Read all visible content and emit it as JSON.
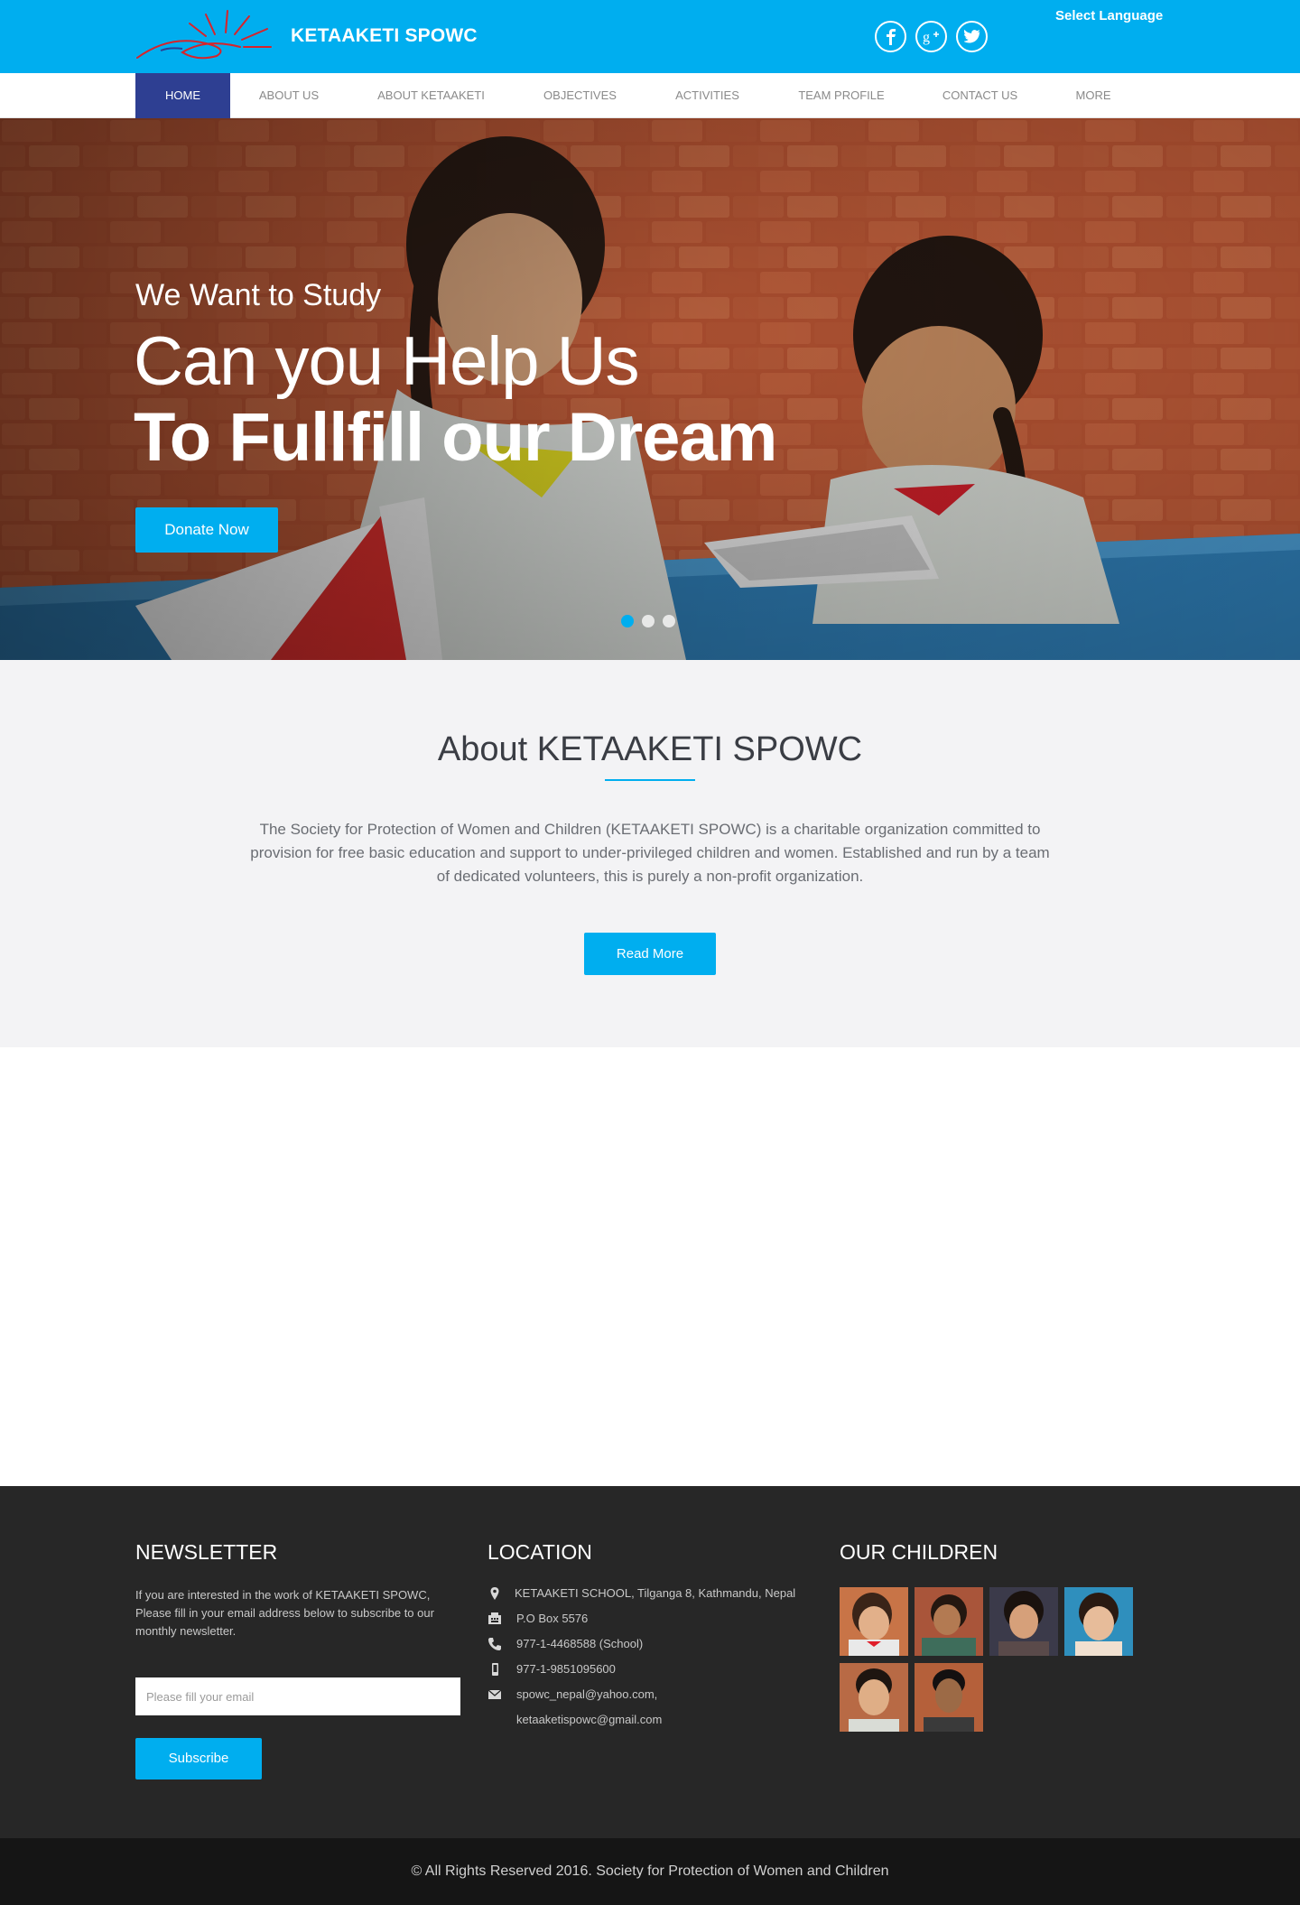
{
  "header": {
    "brand": "KETAAKETI SPOWC",
    "select_language": "Select Language",
    "social": [
      "facebook-icon",
      "google-plus-icon",
      "twitter-icon"
    ]
  },
  "nav": {
    "items": [
      "HOME",
      "ABOUT US",
      "ABOUT KETAAKETI",
      "OBJECTIVES",
      "ACTIVITIES",
      "TEAM PROFILE",
      "CONTACT US",
      "MORE"
    ],
    "active_index": 0
  },
  "hero": {
    "line1": "We Want to Study",
    "line2": "Can you Help Us",
    "line3": "To Fullfill our Dream",
    "donate_label": "Donate Now",
    "slides": 3,
    "active_slide": 0
  },
  "about": {
    "title": "About KETAAKETI SPOWC",
    "text": "The Society for Protection of Women and Children (KETAAKETI SPOWC) is a charitable organization committed to provision for free basic education and support to under-privileged children and women. Established and run by a team of dedicated volunteers, this is purely a non-profit organization.",
    "read_more": "Read More"
  },
  "footer": {
    "newsletter": {
      "title": "NEWSLETTER",
      "text": "If you are interested in the work of KETAAKETI SPOWC, Please fill in your email address below to subscribe to our monthly newsletter.",
      "placeholder": "Please fill your email",
      "subscribe": "Subscribe"
    },
    "location": {
      "title": "LOCATION",
      "address": "KETAAKETI SCHOOL, Tilganga 8, Kathmandu, Nepal",
      "po_box": "P.O Box 5576",
      "phone": "977-1-4468588 (School)",
      "mobile": "977-1-9851095600",
      "email1": "spowc_nepal@yahoo.com,",
      "email2": "ketaaketispowc@gmail.com"
    },
    "children": {
      "title": "OUR CHILDREN",
      "count": 6
    }
  },
  "copyright": "© All Rights Reserved 2016. Society for Protection of Women and Children",
  "colors": {
    "accent": "#00aeef",
    "nav_active": "#2e3f92",
    "footer": "#272727",
    "footer_bottom": "#151515",
    "about_bg": "#f3f3f5"
  }
}
